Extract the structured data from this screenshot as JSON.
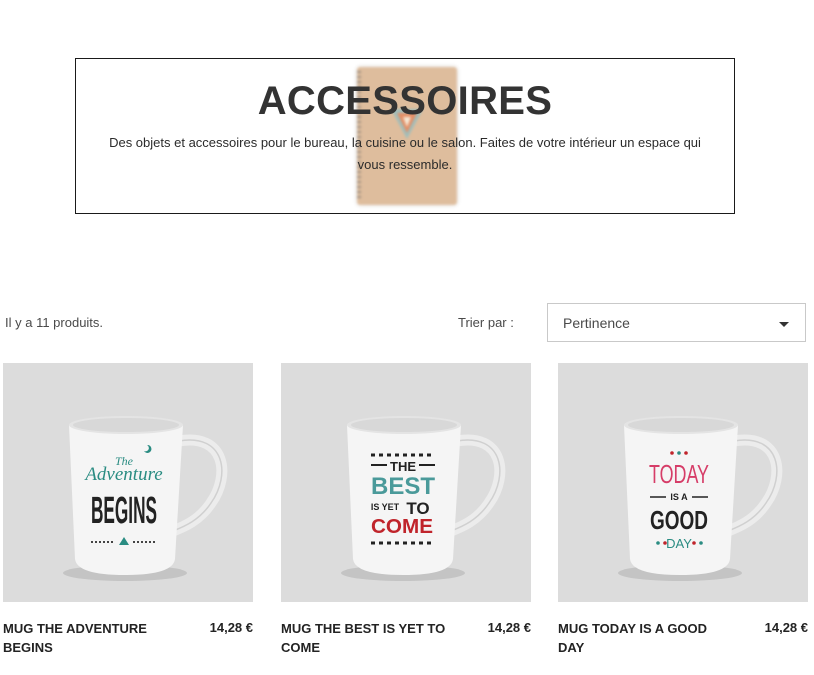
{
  "category": {
    "title": "ACCESSOIRES",
    "description": "Des objets et accessoires pour le bureau, la cuisine ou le salon. Faites de votre intérieur un espace qui vous ressemble."
  },
  "listing": {
    "product_count": "Il y a 11 produits.",
    "sort_label": "Trier par :",
    "sort_value": "Pertinence"
  },
  "products": [
    {
      "name": "Mug The adventure begins",
      "price": "14,28 €",
      "mug_text": [
        "The",
        "Adventure",
        "BEGINS"
      ]
    },
    {
      "name": "Mug The best is yet to come",
      "price": "14,28 €",
      "mug_text": [
        "THE",
        "BEST",
        "IS YET",
        "TO",
        "COME"
      ]
    },
    {
      "name": "Mug Today is a good day",
      "price": "14,28 €",
      "mug_text": [
        "TODAY",
        "IS A",
        "GOOD",
        "DAY"
      ]
    }
  ],
  "colors": {
    "teal": "#2a8c82",
    "red": "#c0242b",
    "pink": "#d63d68",
    "dark": "#222222"
  }
}
